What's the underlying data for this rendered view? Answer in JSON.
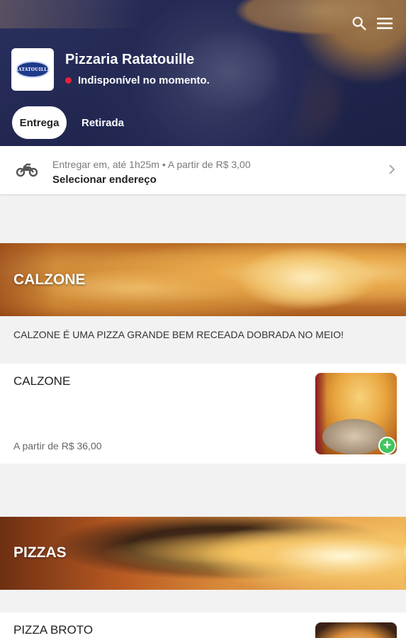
{
  "header": {
    "store_name": "Pizzaria Ratatouille",
    "logo_text": "RATATOUILLE",
    "status": "Indisponível no momento.",
    "status_color": "#e6233a",
    "icons": [
      "search-icon",
      "menu-icon"
    ]
  },
  "tabs": [
    {
      "label": "Entrega",
      "selected": true
    },
    {
      "label": "Retirada",
      "selected": false
    }
  ],
  "delivery": {
    "info": "Entregar em, até 1h25m • A partir de R$ 3,00",
    "action": "Selecionar endereço",
    "icon": "motorcycle-icon"
  },
  "categories": [
    {
      "title": "CALZONE",
      "description": "CALZONE É UMA PIZZA GRANDE BEM RECEADA DOBRADA NO MEIO!",
      "products": [
        {
          "name": "CALZONE",
          "price": "A partir de R$ 36,00",
          "add_label": "+"
        }
      ]
    },
    {
      "title": "PIZZAS",
      "products": [
        {
          "name": "PIZZA BROTO"
        }
      ]
    }
  ],
  "colors": {
    "accent_green": "#3fc55e",
    "status_red": "#e6233a"
  }
}
